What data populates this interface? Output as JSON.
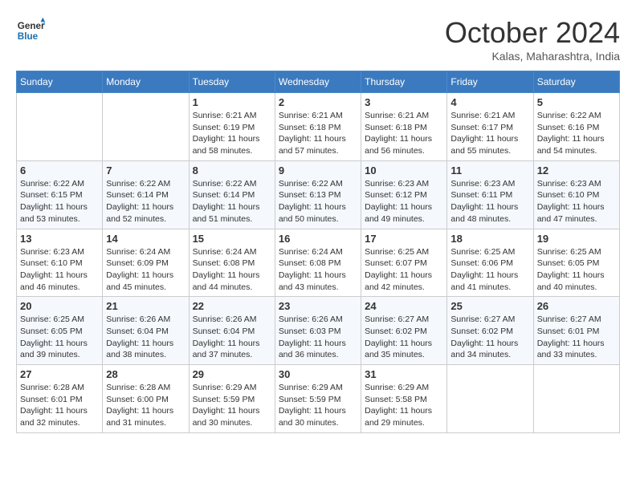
{
  "logo": {
    "line1": "General",
    "line2": "Blue"
  },
  "title": "October 2024",
  "subtitle": "Kalas, Maharashtra, India",
  "days_header": [
    "Sunday",
    "Monday",
    "Tuesday",
    "Wednesday",
    "Thursday",
    "Friday",
    "Saturday"
  ],
  "weeks": [
    [
      {
        "day": "",
        "sunrise": "",
        "sunset": "",
        "daylight": ""
      },
      {
        "day": "",
        "sunrise": "",
        "sunset": "",
        "daylight": ""
      },
      {
        "day": "1",
        "sunrise": "Sunrise: 6:21 AM",
        "sunset": "Sunset: 6:19 PM",
        "daylight": "Daylight: 11 hours and 58 minutes."
      },
      {
        "day": "2",
        "sunrise": "Sunrise: 6:21 AM",
        "sunset": "Sunset: 6:18 PM",
        "daylight": "Daylight: 11 hours and 57 minutes."
      },
      {
        "day": "3",
        "sunrise": "Sunrise: 6:21 AM",
        "sunset": "Sunset: 6:18 PM",
        "daylight": "Daylight: 11 hours and 56 minutes."
      },
      {
        "day": "4",
        "sunrise": "Sunrise: 6:21 AM",
        "sunset": "Sunset: 6:17 PM",
        "daylight": "Daylight: 11 hours and 55 minutes."
      },
      {
        "day": "5",
        "sunrise": "Sunrise: 6:22 AM",
        "sunset": "Sunset: 6:16 PM",
        "daylight": "Daylight: 11 hours and 54 minutes."
      }
    ],
    [
      {
        "day": "6",
        "sunrise": "Sunrise: 6:22 AM",
        "sunset": "Sunset: 6:15 PM",
        "daylight": "Daylight: 11 hours and 53 minutes."
      },
      {
        "day": "7",
        "sunrise": "Sunrise: 6:22 AM",
        "sunset": "Sunset: 6:14 PM",
        "daylight": "Daylight: 11 hours and 52 minutes."
      },
      {
        "day": "8",
        "sunrise": "Sunrise: 6:22 AM",
        "sunset": "Sunset: 6:14 PM",
        "daylight": "Daylight: 11 hours and 51 minutes."
      },
      {
        "day": "9",
        "sunrise": "Sunrise: 6:22 AM",
        "sunset": "Sunset: 6:13 PM",
        "daylight": "Daylight: 11 hours and 50 minutes."
      },
      {
        "day": "10",
        "sunrise": "Sunrise: 6:23 AM",
        "sunset": "Sunset: 6:12 PM",
        "daylight": "Daylight: 11 hours and 49 minutes."
      },
      {
        "day": "11",
        "sunrise": "Sunrise: 6:23 AM",
        "sunset": "Sunset: 6:11 PM",
        "daylight": "Daylight: 11 hours and 48 minutes."
      },
      {
        "day": "12",
        "sunrise": "Sunrise: 6:23 AM",
        "sunset": "Sunset: 6:10 PM",
        "daylight": "Daylight: 11 hours and 47 minutes."
      }
    ],
    [
      {
        "day": "13",
        "sunrise": "Sunrise: 6:23 AM",
        "sunset": "Sunset: 6:10 PM",
        "daylight": "Daylight: 11 hours and 46 minutes."
      },
      {
        "day": "14",
        "sunrise": "Sunrise: 6:24 AM",
        "sunset": "Sunset: 6:09 PM",
        "daylight": "Daylight: 11 hours and 45 minutes."
      },
      {
        "day": "15",
        "sunrise": "Sunrise: 6:24 AM",
        "sunset": "Sunset: 6:08 PM",
        "daylight": "Daylight: 11 hours and 44 minutes."
      },
      {
        "day": "16",
        "sunrise": "Sunrise: 6:24 AM",
        "sunset": "Sunset: 6:08 PM",
        "daylight": "Daylight: 11 hours and 43 minutes."
      },
      {
        "day": "17",
        "sunrise": "Sunrise: 6:25 AM",
        "sunset": "Sunset: 6:07 PM",
        "daylight": "Daylight: 11 hours and 42 minutes."
      },
      {
        "day": "18",
        "sunrise": "Sunrise: 6:25 AM",
        "sunset": "Sunset: 6:06 PM",
        "daylight": "Daylight: 11 hours and 41 minutes."
      },
      {
        "day": "19",
        "sunrise": "Sunrise: 6:25 AM",
        "sunset": "Sunset: 6:05 PM",
        "daylight": "Daylight: 11 hours and 40 minutes."
      }
    ],
    [
      {
        "day": "20",
        "sunrise": "Sunrise: 6:25 AM",
        "sunset": "Sunset: 6:05 PM",
        "daylight": "Daylight: 11 hours and 39 minutes."
      },
      {
        "day": "21",
        "sunrise": "Sunrise: 6:26 AM",
        "sunset": "Sunset: 6:04 PM",
        "daylight": "Daylight: 11 hours and 38 minutes."
      },
      {
        "day": "22",
        "sunrise": "Sunrise: 6:26 AM",
        "sunset": "Sunset: 6:04 PM",
        "daylight": "Daylight: 11 hours and 37 minutes."
      },
      {
        "day": "23",
        "sunrise": "Sunrise: 6:26 AM",
        "sunset": "Sunset: 6:03 PM",
        "daylight": "Daylight: 11 hours and 36 minutes."
      },
      {
        "day": "24",
        "sunrise": "Sunrise: 6:27 AM",
        "sunset": "Sunset: 6:02 PM",
        "daylight": "Daylight: 11 hours and 35 minutes."
      },
      {
        "day": "25",
        "sunrise": "Sunrise: 6:27 AM",
        "sunset": "Sunset: 6:02 PM",
        "daylight": "Daylight: 11 hours and 34 minutes."
      },
      {
        "day": "26",
        "sunrise": "Sunrise: 6:27 AM",
        "sunset": "Sunset: 6:01 PM",
        "daylight": "Daylight: 11 hours and 33 minutes."
      }
    ],
    [
      {
        "day": "27",
        "sunrise": "Sunrise: 6:28 AM",
        "sunset": "Sunset: 6:01 PM",
        "daylight": "Daylight: 11 hours and 32 minutes."
      },
      {
        "day": "28",
        "sunrise": "Sunrise: 6:28 AM",
        "sunset": "Sunset: 6:00 PM",
        "daylight": "Daylight: 11 hours and 31 minutes."
      },
      {
        "day": "29",
        "sunrise": "Sunrise: 6:29 AM",
        "sunset": "Sunset: 5:59 PM",
        "daylight": "Daylight: 11 hours and 30 minutes."
      },
      {
        "day": "30",
        "sunrise": "Sunrise: 6:29 AM",
        "sunset": "Sunset: 5:59 PM",
        "daylight": "Daylight: 11 hours and 30 minutes."
      },
      {
        "day": "31",
        "sunrise": "Sunrise: 6:29 AM",
        "sunset": "Sunset: 5:58 PM",
        "daylight": "Daylight: 11 hours and 29 minutes."
      },
      {
        "day": "",
        "sunrise": "",
        "sunset": "",
        "daylight": ""
      },
      {
        "day": "",
        "sunrise": "",
        "sunset": "",
        "daylight": ""
      }
    ]
  ]
}
